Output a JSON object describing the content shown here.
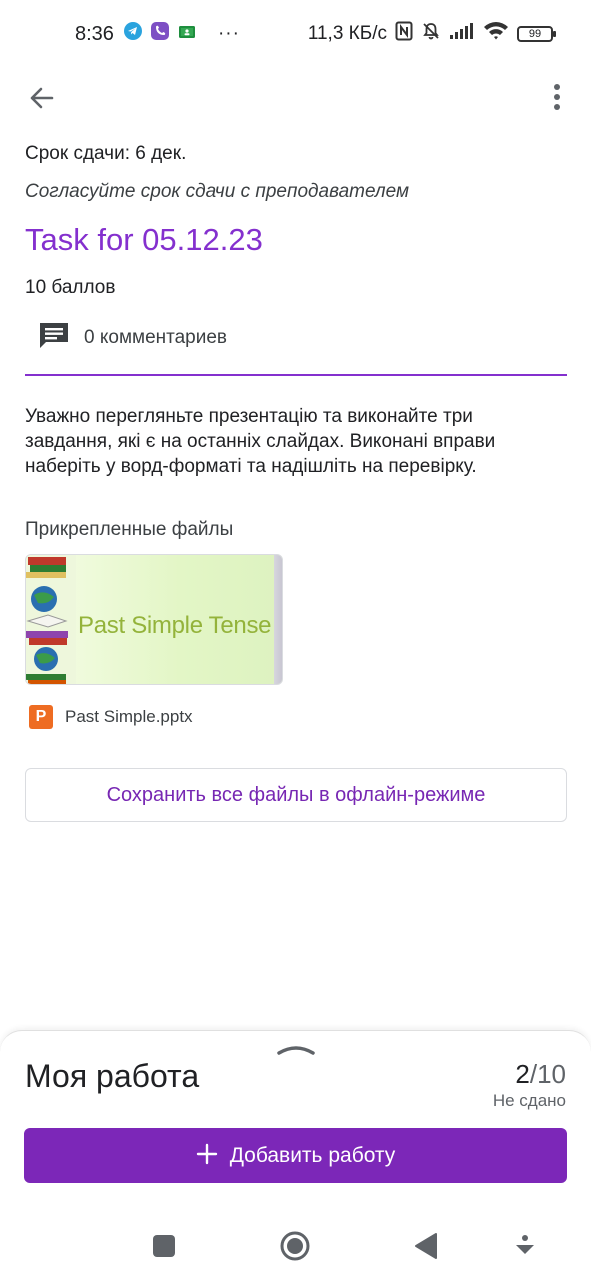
{
  "status_bar": {
    "time": "8:36",
    "more": "···",
    "speed": "11,3 КБ/с",
    "battery": "99",
    "icons": [
      "telegram-icon",
      "viber-icon",
      "classroom-icon",
      "nfc-icon",
      "mute-icon",
      "signal-icon",
      "wifi-icon",
      "battery-icon"
    ]
  },
  "app_bar": {
    "back_icon": "arrow-left-icon",
    "menu_icon": "more-vert-icon"
  },
  "assignment": {
    "due": "Срок сдачи: 6 дек.",
    "agree_note": "Согласуйте срок сдачи с преподавателем",
    "title": "Task for 05.12.23",
    "points": "10 баллов",
    "comments": "0 комментариев",
    "description": "Уважно перегляньте презентацію та виконайте три завдання, які є на останніх слайдах. Виконані вправи наберіть у ворд-форматі та надішліть на перевірку.",
    "attachments_heading": "Прикрепленные файлы",
    "attachment": {
      "preview_title": "Past Simple Tense",
      "badge": "P",
      "file_name": "Past Simple.pptx"
    },
    "save_offline": "Сохранить все файлы в офлайн-режиме"
  },
  "my_work": {
    "title": "Моя работа",
    "grade_num": "2",
    "grade_den": "/10",
    "status": "Не сдано",
    "add_button": "Добавить работу",
    "add_icon": "plus-icon"
  },
  "colors": {
    "accent": "#8430ce",
    "button": "#7c27b8",
    "file_badge": "#ee6c22"
  }
}
